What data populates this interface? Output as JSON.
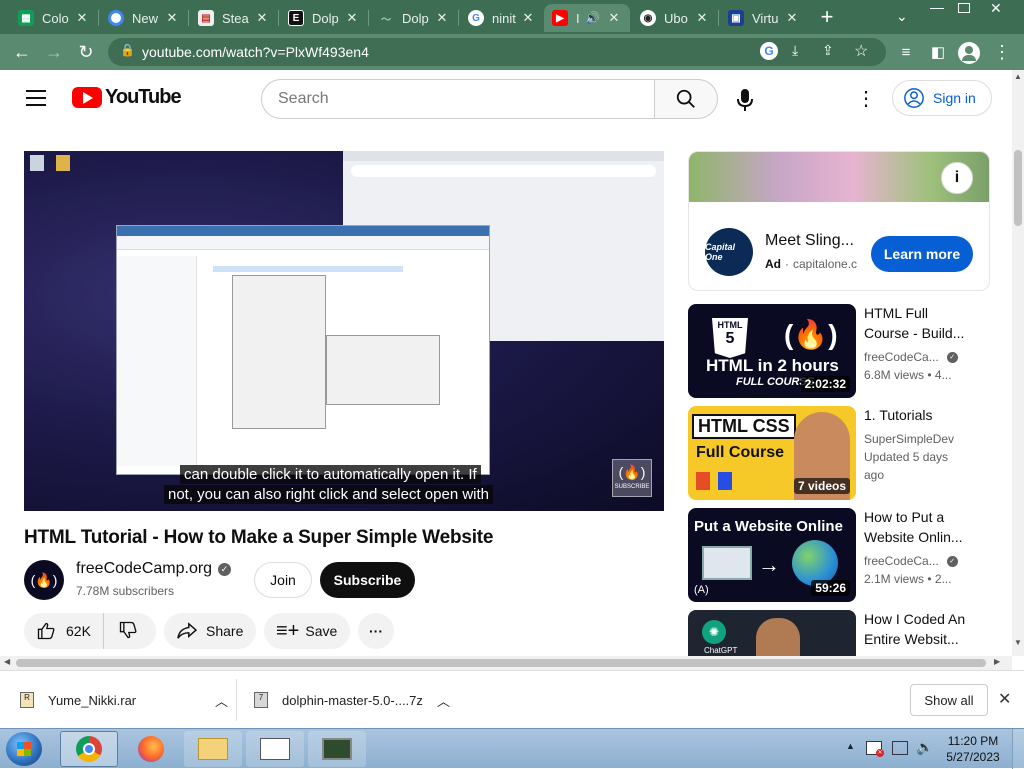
{
  "tabs": [
    {
      "label": "Colo",
      "icon": "sheets-icon",
      "color": "#0f9d58"
    },
    {
      "label": "New",
      "icon": "chrome-icon",
      "color": "#4285f4"
    },
    {
      "label": "Stea",
      "icon": "shop-icon",
      "color": "#c0392b"
    },
    {
      "label": "Dolp",
      "icon": "dolphin-e-icon",
      "color": "#111111"
    },
    {
      "label": "Dolp",
      "icon": "dolphin-logo-icon",
      "color": "#607d6b"
    },
    {
      "label": "ninit",
      "icon": "google-icon",
      "color": "#ffffff"
    },
    {
      "label": "I",
      "icon": "youtube-icon",
      "color": "#ff0000",
      "active": true
    },
    {
      "label": "Ubo",
      "icon": "ublock-icon",
      "color": "#222222"
    },
    {
      "label": "Virtu",
      "icon": "virtualbox-icon",
      "color": "#1c3f94"
    }
  ],
  "toolbar": {
    "url": "youtube.com/watch?v=PlxWf493en4"
  },
  "youtube": {
    "logo_text": "YouTube",
    "search_placeholder": "Search",
    "signin_label": "Sign in",
    "video": {
      "caption_line1": "can double click it to automatically open it. If",
      "caption_line2": "not, you can also right click and select open with",
      "watermark": "SUBSCRIBE"
    },
    "title": "HTML Tutorial - How to Make a Super Simple Website",
    "channel": {
      "name": "freeCodeCamp.org",
      "subscribers": "7.78M subscribers"
    },
    "join_label": "Join",
    "subscribe_label": "Subscribe",
    "actions": {
      "likes": "62K",
      "share": "Share",
      "save": "Save"
    },
    "ad": {
      "title": "Meet Sling...",
      "badge": "Ad",
      "domain": "capitalone.c",
      "cta": "Learn more",
      "logo_text": "Capital One"
    },
    "recommendations": [
      {
        "title_line1": "HTML Full",
        "title_line2": "Course - Build...",
        "channel": "freeCodeCa...",
        "meta1": "6.8M views",
        "meta2": "• 4...",
        "duration": "2:02:32",
        "thumb_text1": "HTML in 2 hours",
        "thumb_text2": "FULL COURSE",
        "thumb_badge": "HTML"
      },
      {
        "title_line1": "1. Tutorials",
        "title_line2": "",
        "channel": "SuperSimpleDev",
        "meta1": "Updated 5 days",
        "meta2": "ago",
        "duration": "7 videos",
        "thumb_text1": "HTML CSS",
        "thumb_text2": "Full Course"
      },
      {
        "title_line1": "How to Put a",
        "title_line2": "Website Onlin...",
        "channel": "freeCodeCa...",
        "meta1": "2.1M views",
        "meta2": "• 2...",
        "duration": "59:26",
        "thumb_text1": "Put a Website Online"
      },
      {
        "title_line1": "How I Coded An",
        "title_line2": "Entire Websit...",
        "channel": "",
        "meta1": "",
        "meta2": "",
        "duration": "",
        "thumb_text1": "ChatGPT"
      }
    ]
  },
  "downloads": {
    "items": [
      {
        "name": "Yume_Nikki.rar"
      },
      {
        "name": "dolphin-master-5.0-....7z"
      }
    ],
    "show_all": "Show all"
  },
  "taskbar": {
    "time": "11:20 PM",
    "date": "5/27/2023"
  },
  "colors": {
    "tabstrip": "#3d6e54",
    "toolbar": "#5a8a6f",
    "youtube_red": "#ff0000",
    "link_blue": "#065fd4",
    "taskbar": "#9bbad8"
  }
}
